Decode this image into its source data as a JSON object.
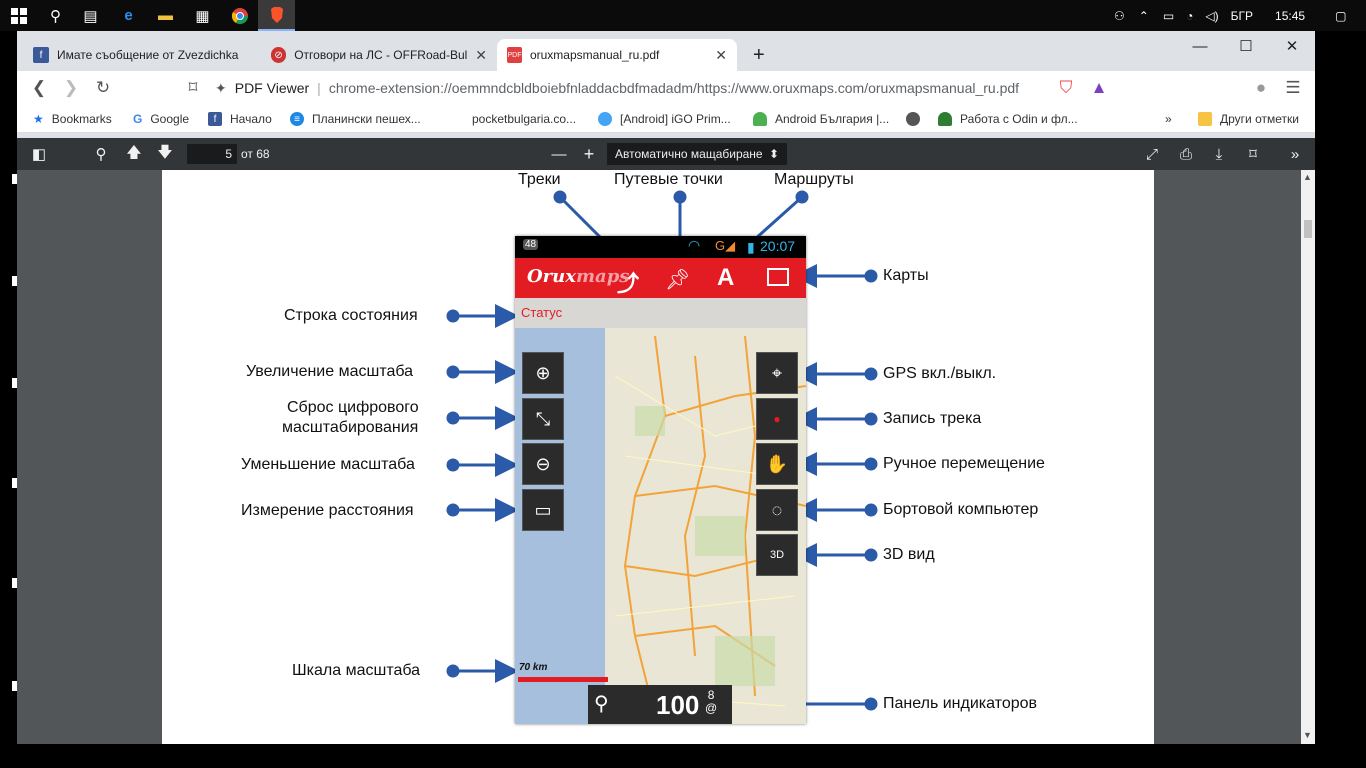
{
  "taskbar": {
    "tray": {
      "lang": "БГР",
      "time": "15:45"
    }
  },
  "browser": {
    "tabs": [
      {
        "title": "Имате съобщение от Zvezdichka.",
        "fav_color": "#3b5998"
      },
      {
        "title": "Отговори на ЛС - OFFRoad-Bulga",
        "fav_color": "#cc3333"
      },
      {
        "title": "oruxmapsmanual_ru.pdf",
        "fav_color": "#e04040"
      }
    ],
    "omnibox": {
      "site": "PDF Viewer",
      "url": "chrome-extension://oemmndcbldboiebfnladdacbdfmadadm/https://www.oruxmaps.com/oruxmapsmanual_ru.pdf"
    },
    "bookmarks": [
      {
        "label": "Bookmarks",
        "color": "#1a73e8"
      },
      {
        "label": "Google",
        "color": "#4285f4"
      },
      {
        "label": "Начало",
        "color": "#3b5998"
      },
      {
        "label": "Планински пешех...",
        "color": "#1e88e5"
      },
      {
        "label": "pocketbulgaria.co...",
        "color": "#888888"
      },
      {
        "label": "[Android] iGO Prim...",
        "color": "#42a5f5"
      },
      {
        "label": "Android България |...",
        "color": "#4caf50"
      },
      {
        "label": "",
        "color": "#555555"
      },
      {
        "label": "Работа с Odin и фл...",
        "color": "#2e7d32"
      }
    ],
    "other_bookmarks": "Други отметки"
  },
  "pdf_toolbar": {
    "page_current": "5",
    "page_total": "от 68",
    "zoom": "Автоматично мащабиране"
  },
  "pdf_content": {
    "top_labels": {
      "tracks": "Треки",
      "waypoints": "Путевые точки",
      "routes": "Маршруты"
    },
    "left_labels": {
      "status_row": "Строка состояния",
      "zoom_in": "Увеличение масштаба",
      "reset_zoom_1": "Сброс цифрового",
      "reset_zoom_2": "масштабирования",
      "zoom_out": "Уменьшение масштаба",
      "measure": "Измерение расстояния",
      "scale": "Шкала масштаба"
    },
    "right_labels": {
      "maps": "Карты",
      "gps": "GPS вкл./выкл.",
      "record": "Запись трека",
      "manual": "Ручное перемещение",
      "computer": "Бортовой компьютер",
      "view3d": "3D вид",
      "indicators": "Панель индикаторов"
    },
    "phone": {
      "status_left": "48",
      "time": "20:07",
      "logo_a": "Orux",
      "logo_b": "maps",
      "status_text": "Статус",
      "scale": "70 km",
      "indicator_value": "100",
      "indicator_sub_1": "8",
      "indicator_sub_2": "@"
    }
  }
}
